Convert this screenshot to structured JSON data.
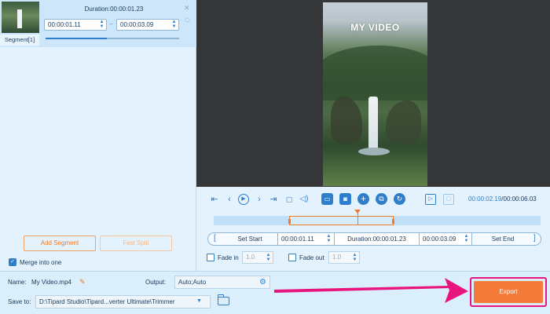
{
  "segment": {
    "thumb_caption": "Segment[1]",
    "duration_text": "Duration:00:00:01.23",
    "start": "00:00:01.11",
    "end": "00:00:03.09",
    "progress": 0.46
  },
  "left_panel": {
    "add_segment_label": "Add Segment",
    "fast_split_label": "Fast Split",
    "merge_label": "Merge into one",
    "merge_checked": true
  },
  "preview": {
    "video_title": "MY VIDEO"
  },
  "playback": {
    "current_time": "00:00:02.19",
    "total_time": "/00:00:06.03",
    "icons": [
      "to-start-icon",
      "prev-frame-icon",
      "play-icon",
      "next-frame-icon",
      "to-end-icon",
      "stop-icon",
      "volume-icon",
      "copy-segment-icon",
      "snapshot-icon",
      "add-icon",
      "duplicate-icon",
      "rotate-icon",
      "speed-icon",
      "fullscreen-icon"
    ]
  },
  "timeline": {
    "selection_start_fraction": 0.23,
    "selection_end_fraction": 0.55,
    "playhead_fraction": 0.44
  },
  "range": {
    "set_start_label": "Set Start",
    "start": "00:00:01.11",
    "duration": "Duration:00:00:01.23",
    "end": "00:00:03.09",
    "set_end_label": "Set End"
  },
  "fade": {
    "fade_in_label": "Fade in",
    "fade_in_value": "1.0",
    "fade_out_label": "Fade out",
    "fade_out_value": "1.0"
  },
  "bottom": {
    "name_label": "Name:",
    "name_value": "My Video.mp4",
    "output_label": "Output:",
    "output_value": "Auto;Auto",
    "save_label": "Save to:",
    "save_path": "D:\\Tipard Studio\\Tipard...verter Ultimate\\Trimmer",
    "export_label": "Export"
  },
  "colors": {
    "accent": "#2f7ecb",
    "orange": "#f07a2a",
    "annotation": "#e8157f"
  }
}
